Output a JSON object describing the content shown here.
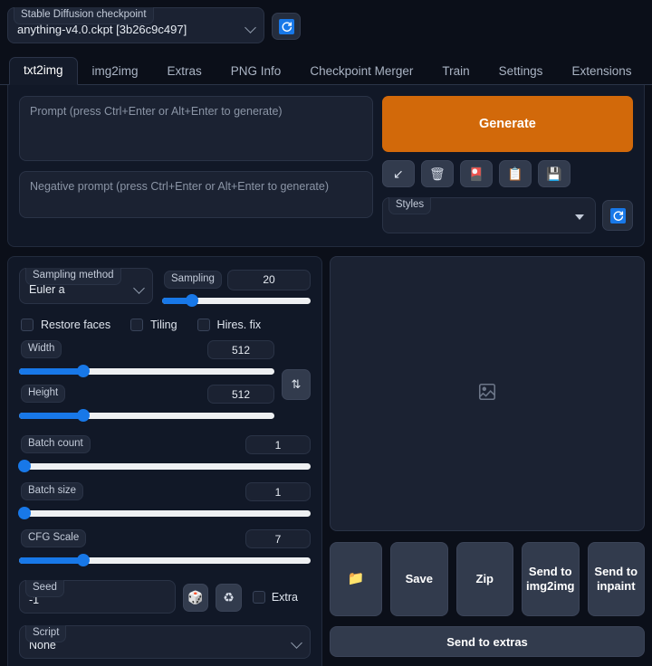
{
  "checkpoint": {
    "label": "Stable Diffusion checkpoint",
    "value": "anything-v4.0.ckpt [3b26c9c497]",
    "refresh_icon": "refresh-icon"
  },
  "tabs": [
    {
      "label": "txt2img",
      "active": true
    },
    {
      "label": "img2img",
      "active": false
    },
    {
      "label": "Extras",
      "active": false
    },
    {
      "label": "PNG Info",
      "active": false
    },
    {
      "label": "Checkpoint Merger",
      "active": false
    },
    {
      "label": "Train",
      "active": false
    },
    {
      "label": "Settings",
      "active": false
    },
    {
      "label": "Extensions",
      "active": false
    }
  ],
  "prompt": {
    "placeholder": "Prompt (press Ctrl+Enter or Alt+Enter to generate)",
    "value": ""
  },
  "negative_prompt": {
    "placeholder": "Negative prompt (press Ctrl+Enter or Alt+Enter to generate)",
    "value": ""
  },
  "generate": {
    "label": "Generate",
    "color": "#d2690a"
  },
  "prompt_tools": [
    {
      "name": "arrow-down-left-icon",
      "glyph": "↙"
    },
    {
      "name": "trash-icon",
      "glyph": "🗑"
    },
    {
      "name": "apply-style-card-icon",
      "glyph": "🎴"
    },
    {
      "name": "clipboard-icon",
      "glyph": "📋"
    },
    {
      "name": "floppy-save-icon",
      "glyph": "💾"
    }
  ],
  "styles": {
    "label": "Styles",
    "value": "",
    "refresh_icon": "refresh-icon"
  },
  "sampling_method": {
    "label": "Sampling method",
    "value": "Euler a"
  },
  "sampling_steps": {
    "label": "Sampling",
    "value": "20",
    "percent": 20
  },
  "checkboxes": [
    {
      "label": "Restore faces",
      "checked": false
    },
    {
      "label": "Tiling",
      "checked": false
    },
    {
      "label": "Hires. fix",
      "checked": false
    }
  ],
  "width": {
    "label": "Width",
    "value": "512",
    "percent": 25
  },
  "height": {
    "label": "Height",
    "value": "512",
    "percent": 25
  },
  "swap_button": {
    "name": "swap-dimensions-icon",
    "glyph": "⇅"
  },
  "batch_count": {
    "label": "Batch count",
    "value": "1",
    "percent": 0
  },
  "batch_size": {
    "label": "Batch size",
    "value": "1",
    "percent": 0
  },
  "cfg_scale": {
    "label": "CFG Scale",
    "value": "7",
    "percent": 22
  },
  "seed": {
    "label": "Seed",
    "value": "-1",
    "dice_icon": {
      "name": "dice-icon",
      "glyph": "🎲"
    },
    "recycle_icon": {
      "name": "recycle-icon",
      "glyph": "♻"
    },
    "extra_label": "Extra",
    "extra_checked": false
  },
  "script": {
    "label": "Script",
    "value": "None"
  },
  "gallery": {
    "placeholder_icon": "image-placeholder-icon"
  },
  "output_buttons": [
    {
      "label": "",
      "name": "open-folder-button",
      "icon": "folder-icon",
      "glyph": "📁"
    },
    {
      "label": "Save",
      "name": "save-button"
    },
    {
      "label": "Zip",
      "name": "zip-button"
    },
    {
      "label": "Send to img2img",
      "name": "send-to-img2img-button"
    },
    {
      "label": "Send to inpaint",
      "name": "send-to-inpaint-button"
    }
  ],
  "send_to_extras": {
    "label": "Send to extras"
  }
}
